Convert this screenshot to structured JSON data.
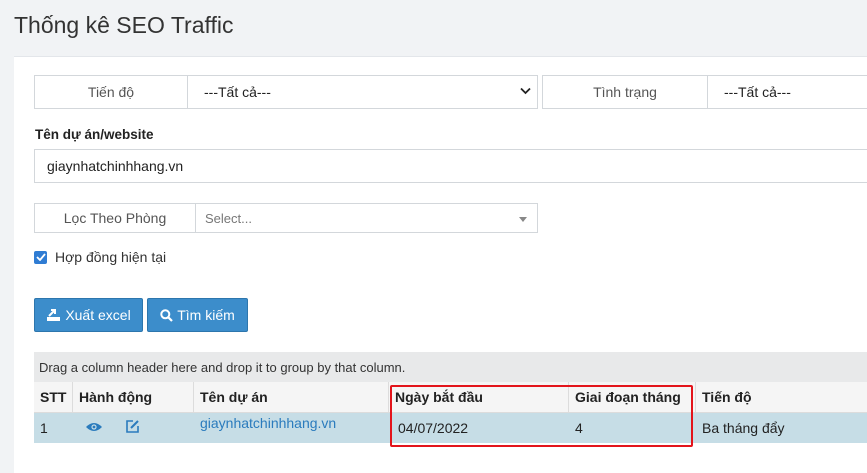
{
  "page": {
    "title": "Thống kê SEO Traffic"
  },
  "filters": {
    "progress_label": "Tiến độ",
    "progress_value": "---Tất cả---",
    "status_label": "Tình trạng",
    "status_value": "---Tất cả---",
    "project_label": "Tên dự án/website",
    "project_value": "giaynhatchinhhang.vn",
    "room_label": "Lọc Theo Phòng",
    "room_placeholder": "Select...",
    "current_contract_label": "Hợp đồng hiện tại",
    "current_contract_checked": true
  },
  "buttons": {
    "export": "Xuất excel",
    "search": "Tìm kiếm"
  },
  "grid": {
    "group_hint": "Drag a column header here and drop it to group by that column.",
    "columns": [
      "STT",
      "Hành động",
      "Tên dự án",
      "Ngày bắt đầu",
      "Giai đoạn tháng",
      "Tiến độ"
    ],
    "rows": [
      {
        "stt": "1",
        "project": "giaynhatchinhhang.vn",
        "start_date": "04/07/2022",
        "phase": "4",
        "progress": "Ba tháng đẩy"
      }
    ]
  },
  "colors": {
    "accent": "#3c8dcb",
    "highlight": "#e3141b",
    "row_selected": "#c6dde6"
  }
}
